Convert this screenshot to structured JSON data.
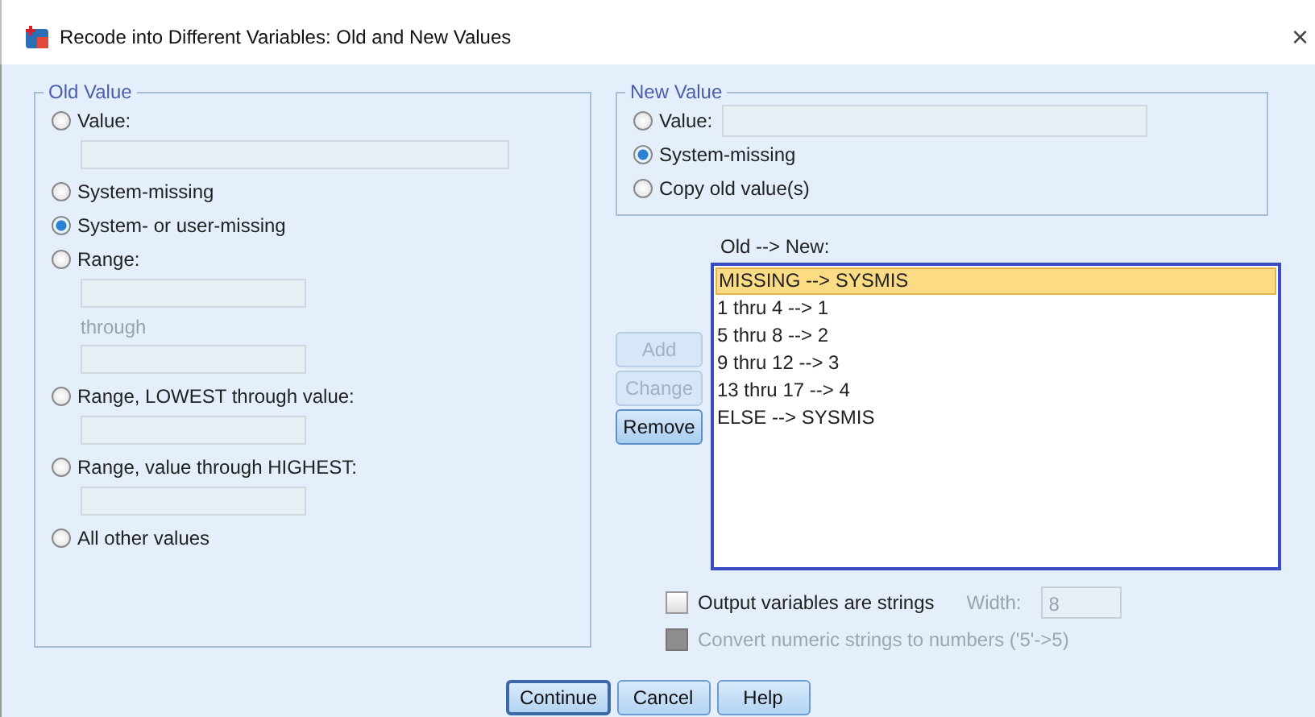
{
  "window": {
    "title": "Recode into Different Variables: Old and New Values",
    "close": "×"
  },
  "old_value": {
    "legend": "Old Value",
    "options": [
      {
        "label": "Value:",
        "selected": false,
        "kind": "wide_field"
      },
      {
        "label": "System-missing",
        "selected": false,
        "kind": "plain"
      },
      {
        "label": "System- or user-missing",
        "selected": true,
        "kind": "plain"
      },
      {
        "label": "Range:",
        "selected": false,
        "kind": "range",
        "through_label": "through"
      },
      {
        "label": "Range, LOWEST through value:",
        "selected": false,
        "kind": "narrow_field"
      },
      {
        "label": "Range, value through HIGHEST:",
        "selected": false,
        "kind": "narrow_field"
      },
      {
        "label": "All other values",
        "selected": false,
        "kind": "plain"
      }
    ]
  },
  "new_value": {
    "legend": "New Value",
    "options": [
      {
        "label": "Value:",
        "selected": false,
        "kind": "inline_field"
      },
      {
        "label": "System-missing",
        "selected": true,
        "kind": "plain"
      },
      {
        "label": "Copy old value(s)",
        "selected": false,
        "kind": "plain"
      }
    ]
  },
  "list": {
    "label": "Old --> New:",
    "items": [
      {
        "text": "MISSING --> SYSMIS",
        "selected": true
      },
      {
        "text": "1 thru 4 --> 1",
        "selected": false
      },
      {
        "text": "5 thru 8 --> 2",
        "selected": false
      },
      {
        "text": "9 thru 12 --> 3",
        "selected": false
      },
      {
        "text": "13 thru 17 --> 4",
        "selected": false
      },
      {
        "text": "ELSE --> SYSMIS",
        "selected": false
      }
    ]
  },
  "list_buttons": [
    {
      "label": "Add",
      "disabled": true
    },
    {
      "label": "Change",
      "disabled": true
    },
    {
      "label": "Remove",
      "disabled": false
    }
  ],
  "checkboxes": [
    {
      "label": "Output variables are strings",
      "checked": false,
      "disabled": false
    },
    {
      "label": "Convert numeric strings to numbers ('5'->5)",
      "checked": false,
      "disabled": true
    }
  ],
  "width": {
    "label": "Width:",
    "value": "8",
    "disabled": true
  },
  "buttons": [
    {
      "label": "Continue",
      "default": true
    },
    {
      "label": "Cancel",
      "default": false
    },
    {
      "label": "Help",
      "default": false
    }
  ]
}
